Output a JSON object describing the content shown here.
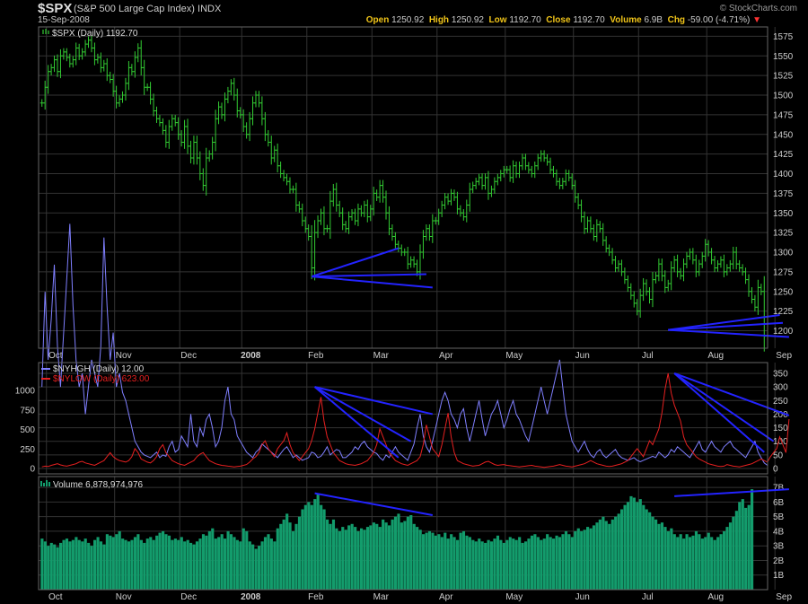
{
  "header": {
    "symbol": "$SPX",
    "name": "(S&P 500 Large Cap Index)",
    "exchange": "INDX",
    "date": "15-Sep-2008",
    "brand": "© StockCharts.com",
    "open_label": "Open",
    "open": "1250.92",
    "high_label": "High",
    "high": "1250.92",
    "low_label": "Low",
    "low": "1192.70",
    "close_label": "Close",
    "close": "1192.70",
    "volume_label": "Volume",
    "volume": "6.9B",
    "chg_label": "Chg",
    "chg": "-59.00 (-4.71%)",
    "chg_arrow": "▼"
  },
  "colors": {
    "price": "#33cc33",
    "nyhgh": "#7f7fff",
    "nylow": "#e62020",
    "volume": "#139c6c",
    "trendline": "#2323ff",
    "grid": "#333333",
    "panel_border": "#666666"
  },
  "chart_data": [
    {
      "type": "line",
      "style": "ohlc-bars",
      "legend": "$SPX (Daily) 1192.70",
      "ylim": [
        1180,
        1580
      ],
      "y_ticks": [
        1200,
        1225,
        1250,
        1275,
        1300,
        1325,
        1350,
        1375,
        1400,
        1425,
        1450,
        1475,
        1500,
        1525,
        1550,
        1575
      ],
      "month_labels": [
        "Oct",
        "Nov",
        "Dec",
        "2008",
        "Feb",
        "Mar",
        "Apr",
        "May",
        "Jun",
        "Jul",
        "Aug",
        "Sep"
      ],
      "series": [
        {
          "values": [
            1490,
            1510,
            1530,
            1535,
            1545,
            1530,
            1550,
            1555,
            1548,
            1540,
            1545,
            1560,
            1550,
            1555,
            1565,
            1570,
            1560,
            1545,
            1548,
            1535,
            1540,
            1525,
            1520,
            1505,
            1490,
            1495,
            1500,
            1515,
            1535,
            1530,
            1548,
            1560,
            1535,
            1510,
            1510,
            1495,
            1480,
            1470,
            1465,
            1455,
            1440,
            1460,
            1470,
            1465,
            1450,
            1440,
            1460,
            1435,
            1420,
            1440,
            1420,
            1400,
            1385,
            1420,
            1425,
            1440,
            1470,
            1485,
            1475,
            1495,
            1505,
            1515,
            1500,
            1480,
            1475,
            1460,
            1450,
            1470,
            1490,
            1500,
            1490,
            1470,
            1450,
            1440,
            1420,
            1430,
            1410,
            1400,
            1395,
            1390,
            1380,
            1380,
            1360,
            1355,
            1340,
            1330,
            1320,
            1280,
            1325,
            1340,
            1350,
            1330,
            1330,
            1365,
            1380,
            1360,
            1350,
            1335,
            1330,
            1345,
            1350,
            1340,
            1355,
            1350,
            1360,
            1345,
            1355,
            1375,
            1370,
            1385,
            1370,
            1350,
            1330,
            1320,
            1310,
            1305,
            1300,
            1300,
            1285,
            1290,
            1285,
            1275,
            1300,
            1320,
            1330,
            1320,
            1340,
            1340,
            1350,
            1360,
            1370,
            1365,
            1375,
            1370,
            1355,
            1350,
            1345,
            1360,
            1380,
            1385,
            1390,
            1395,
            1385,
            1395,
            1375,
            1380,
            1390,
            1395,
            1400,
            1405,
            1405,
            1395,
            1410,
            1400,
            1410,
            1420,
            1410,
            1405,
            1400,
            1410,
            1420,
            1425,
            1420,
            1415,
            1405,
            1400,
            1390,
            1385,
            1390,
            1400,
            1395,
            1385,
            1370,
            1360,
            1345,
            1330,
            1340,
            1330,
            1320,
            1335,
            1330,
            1315,
            1305,
            1300,
            1290,
            1280,
            1285,
            1275,
            1265,
            1255,
            1245,
            1235,
            1225,
            1245,
            1260,
            1250,
            1240,
            1265,
            1270,
            1285,
            1270,
            1255,
            1260,
            1280,
            1290,
            1275,
            1270,
            1285,
            1295,
            1300,
            1290,
            1275,
            1285,
            1295,
            1310,
            1300,
            1290,
            1280,
            1285,
            1290,
            1275,
            1280,
            1285,
            1300,
            1285,
            1280,
            1275,
            1265,
            1250,
            1240,
            1230,
            1255,
            1250,
            1193
          ]
        }
      ]
    },
    {
      "type": "line",
      "legend": [
        "$NYHGH (Daily) 12.00",
        "$NYLOW (Daily) 623.00"
      ],
      "left_ticks": [
        0,
        250,
        500,
        750,
        1000
      ],
      "right_ticks": [
        0,
        50,
        100,
        150,
        200,
        250,
        300,
        350
      ],
      "series": [
        {
          "name": "$NYHGH (Daily)",
          "values": [
            300,
            650,
            400,
            550,
            750,
            450,
            300,
            500,
            700,
            900,
            600,
            400,
            300,
            350,
            200,
            300,
            400,
            350,
            300,
            450,
            850,
            600,
            400,
            500,
            300,
            350,
            280,
            250,
            200,
            150,
            100,
            80,
            60,
            50,
            45,
            40,
            50,
            60,
            40,
            50,
            45,
            80,
            100,
            60,
            70,
            120,
            100,
            80,
            200,
            100,
            80,
            150,
            120,
            180,
            200,
            150,
            80,
            100,
            150,
            250,
            300,
            200,
            180,
            120,
            100,
            80,
            60,
            50,
            40,
            60,
            70,
            90,
            80,
            70,
            60,
            50,
            40,
            55,
            70,
            80,
            60,
            40,
            50,
            40,
            30,
            35,
            40,
            60,
            55,
            40,
            45,
            60,
            80,
            50,
            60,
            70,
            65,
            40,
            40,
            50,
            60,
            80,
            70,
            90,
            100,
            80,
            70,
            60,
            55,
            40,
            30,
            50,
            40,
            60,
            80,
            60,
            50,
            40,
            30,
            60,
            90,
            150,
            200,
            120,
            80,
            60,
            100,
            150,
            200,
            250,
            280,
            250,
            200,
            180,
            150,
            200,
            220,
            150,
            100,
            150,
            200,
            250,
            180,
            120,
            160,
            200,
            220,
            250,
            200,
            150,
            180,
            220,
            250,
            200,
            180,
            150,
            120,
            100,
            150,
            200,
            250,
            300,
            250,
            200,
            250,
            300,
            350,
            400,
            300,
            200,
            150,
            100,
            80,
            60,
            80,
            100,
            70,
            50,
            40,
            60,
            70,
            50,
            40,
            50,
            60,
            70,
            50,
            40,
            35,
            30,
            35,
            40,
            30,
            25,
            30,
            35,
            40,
            45,
            40,
            60,
            50,
            40,
            50,
            70,
            60,
            80,
            70,
            60,
            50,
            40,
            60,
            80,
            100,
            70,
            60,
            80,
            100,
            80,
            70,
            60,
            80,
            90,
            100,
            80,
            70,
            60,
            50,
            40,
            60,
            80,
            100,
            60,
            40,
            20,
            12
          ]
        },
        {
          "name": "$NYLOW (Daily)",
          "values": [
            20,
            30,
            25,
            40,
            50,
            60,
            45,
            35,
            30,
            40,
            50,
            60,
            80,
            90,
            70,
            60,
            50,
            40,
            60,
            80,
            100,
            150,
            200,
            150,
            120,
            100,
            90,
            80,
            100,
            150,
            250,
            200,
            120,
            100,
            80,
            70,
            100,
            150,
            250,
            300,
            200,
            150,
            100,
            80,
            60,
            50,
            40,
            60,
            80,
            100,
            150,
            180,
            200,
            150,
            100,
            80,
            60,
            50,
            40,
            35,
            30,
            25,
            20,
            25,
            30,
            40,
            50,
            80,
            120,
            150,
            200,
            300,
            350,
            250,
            200,
            150,
            250,
            300,
            350,
            450,
            300,
            200,
            150,
            100,
            150,
            200,
            250,
            350,
            500,
            700,
            900,
            600,
            400,
            300,
            200,
            150,
            100,
            80,
            60,
            50,
            45,
            40,
            50,
            60,
            80,
            100,
            150,
            200,
            300,
            500,
            400,
            300,
            200,
            150,
            100,
            80,
            60,
            50,
            40,
            60,
            80,
            100,
            150,
            300,
            550,
            400,
            250,
            200,
            150,
            300,
            500,
            700,
            400,
            200,
            100,
            80,
            60,
            50,
            40,
            30,
            35,
            40,
            60,
            80,
            90,
            70,
            50,
            40,
            45,
            50,
            40,
            35,
            30,
            25,
            20,
            25,
            30,
            35,
            40,
            30,
            25,
            20,
            15,
            20,
            25,
            30,
            40,
            50,
            40,
            30,
            25,
            20,
            30,
            40,
            50,
            60,
            80,
            100,
            80,
            60,
            50,
            40,
            30,
            25,
            30,
            40,
            50,
            60,
            80,
            100,
            150,
            200,
            250,
            200,
            150,
            250,
            350,
            300,
            400,
            500,
            700,
            1000,
            1200,
            950,
            800,
            700,
            600,
            400,
            300,
            250,
            200,
            150,
            120,
            100,
            80,
            60,
            50,
            40,
            30,
            25,
            30,
            50,
            40,
            30,
            25,
            20,
            30,
            40,
            50,
            60,
            80,
            100,
            120,
            100,
            80,
            150,
            200,
            250,
            400,
            300,
            200,
            623
          ]
        }
      ]
    },
    {
      "type": "bar",
      "legend": "Volume 6,878,974,976",
      "unit": "B",
      "ylim": [
        0,
        7.5
      ],
      "y_ticks": [
        1,
        2,
        3,
        4,
        5,
        6,
        7
      ],
      "series": [
        {
          "name": "Volume",
          "values": [
            3.5,
            3.3,
            3.0,
            3.2,
            3.1,
            2.9,
            3.2,
            3.4,
            3.5,
            3.3,
            3.4,
            3.6,
            3.4,
            3.3,
            3.5,
            3.2,
            3.0,
            3.4,
            3.6,
            3.3,
            3.1,
            3.8,
            3.7,
            3.6,
            3.8,
            4.0,
            3.5,
            3.4,
            3.3,
            3.4,
            3.6,
            3.8,
            3.4,
            3.2,
            3.5,
            3.6,
            3.4,
            3.7,
            3.9,
            4.0,
            3.8,
            3.7,
            3.4,
            3.5,
            3.4,
            3.6,
            3.3,
            3.4,
            3.2,
            3.1,
            3.3,
            3.5,
            3.8,
            3.7,
            4.0,
            4.2,
            3.5,
            3.6,
            3.8,
            3.5,
            4.0,
            3.8,
            3.6,
            3.4,
            3.3,
            4.2,
            4.0,
            3.3,
            3.1,
            2.8,
            3.0,
            3.3,
            3.6,
            3.8,
            3.5,
            3.3,
            4.2,
            4.5,
            4.8,
            5.2,
            4.6,
            4.0,
            4.5,
            5.0,
            5.5,
            5.8,
            6.0,
            5.8,
            6.2,
            6.6,
            5.8,
            5.5,
            4.8,
            4.5,
            4.8,
            4.2,
            4.0,
            4.3,
            4.1,
            4.4,
            4.5,
            4.3,
            4.0,
            4.2,
            4.1,
            4.3,
            4.4,
            4.6,
            4.5,
            4.3,
            4.8,
            4.6,
            4.4,
            4.8,
            5.0,
            5.2,
            4.6,
            4.7,
            5.0,
            5.1,
            4.5,
            4.3,
            4.1,
            3.8,
            3.9,
            4.0,
            3.9,
            3.7,
            3.8,
            3.6,
            3.9,
            3.5,
            3.8,
            3.6,
            3.4,
            3.9,
            4.0,
            3.7,
            3.6,
            3.4,
            3.3,
            3.5,
            3.3,
            3.2,
            3.4,
            3.3,
            3.5,
            3.7,
            3.4,
            3.2,
            3.4,
            3.6,
            3.5,
            3.4,
            3.6,
            3.2,
            3.3,
            3.5,
            3.7,
            3.8,
            3.6,
            3.4,
            3.5,
            3.8,
            3.6,
            3.5,
            3.7,
            3.6,
            3.8,
            4.0,
            3.8,
            3.6,
            4.0,
            4.2,
            4.0,
            4.1,
            4.3,
            4.2,
            4.4,
            4.6,
            4.8,
            5.0,
            4.7,
            4.5,
            4.8,
            5.0,
            5.2,
            5.5,
            5.8,
            6.0,
            6.4,
            6.3,
            6.0,
            6.2,
            5.8,
            5.5,
            5.3,
            5.0,
            4.8,
            4.5,
            4.6,
            4.3,
            4.0,
            4.2,
            3.8,
            3.6,
            3.8,
            3.5,
            3.8,
            3.6,
            3.7,
            4.0,
            3.8,
            3.5,
            3.6,
            3.9,
            3.6,
            3.4,
            3.6,
            3.8,
            4.0,
            4.3,
            4.6,
            5.0,
            5.4,
            6.0,
            6.2,
            5.6,
            5.8,
            6.88
          ]
        }
      ]
    }
  ]
}
